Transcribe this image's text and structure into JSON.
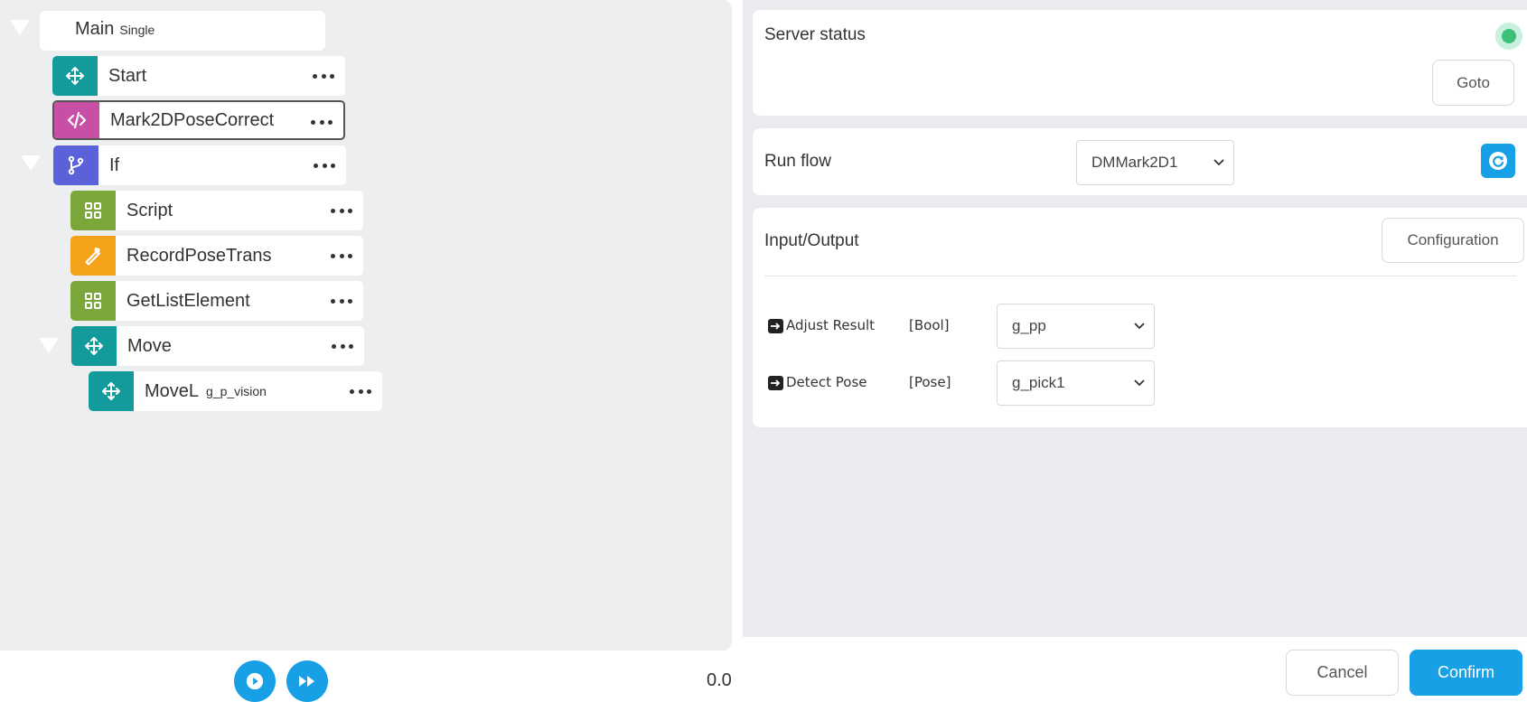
{
  "flow": {
    "main": {
      "label": "Main",
      "sub": "Single"
    },
    "nodes": [
      {
        "label": "Start",
        "sub": "",
        "icon": "move-arrows-icon",
        "color": "#139b9b"
      },
      {
        "label": "Mark2DPoseCorrect",
        "sub": "",
        "icon": "code-icon",
        "color": "#c94fa6"
      },
      {
        "label": "If",
        "sub": "",
        "icon": "branch-icon",
        "color": "#5a61d9"
      },
      {
        "label": "Script",
        "sub": "",
        "icon": "grid-icon",
        "color": "#7ba63a"
      },
      {
        "label": "RecordPoseTrans",
        "sub": "",
        "icon": "wrench-icon",
        "color": "#f5a21b"
      },
      {
        "label": "GetListElement",
        "sub": "",
        "icon": "grid-icon",
        "color": "#7ba63a"
      },
      {
        "label": "Move",
        "sub": "",
        "icon": "move-arrows-icon",
        "color": "#139b9b"
      },
      {
        "label": "MoveL",
        "sub": "g_p_vision",
        "icon": "move-arrows-icon",
        "color": "#139b9b"
      }
    ]
  },
  "player": {
    "speed": "0.0",
    "accent": "#17a0e6"
  },
  "server": {
    "title": "Server status",
    "status_color": "#3cc07a",
    "goto_label": "Goto"
  },
  "run_flow": {
    "title": "Run flow",
    "selected": "DMMark2D1"
  },
  "io": {
    "title": "Input/Output",
    "config_label": "Configuration",
    "rows": [
      {
        "name": "Adjust Result",
        "type": "[Bool]",
        "value": "g_pp"
      },
      {
        "name": "Detect Pose",
        "type": "[Pose]",
        "value": "g_pick1"
      }
    ]
  },
  "footer": {
    "cancel_label": "Cancel",
    "confirm_label": "Confirm"
  }
}
